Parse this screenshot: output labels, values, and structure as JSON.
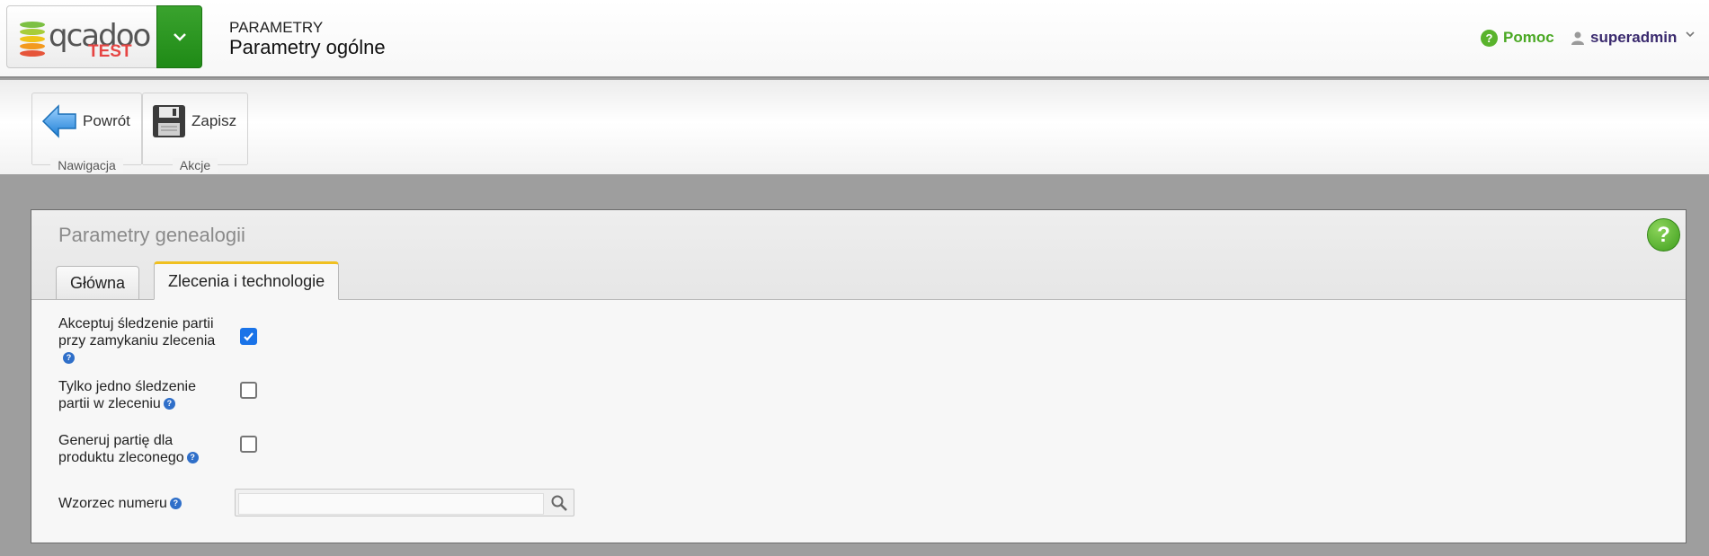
{
  "header": {
    "logo_word": "qcadoo",
    "logo_env": "TEST",
    "section": "PARAMETRY",
    "title": "Parametry ogólne",
    "help_label": "Pomoc",
    "user_label": "superadmin"
  },
  "ribbon": {
    "groups": [
      {
        "caption": "Nawigacja",
        "button": "Powrót",
        "icon": "back-arrow-icon"
      },
      {
        "caption": "Akcje",
        "button": "Zapisz",
        "icon": "floppy-disk-icon"
      }
    ]
  },
  "panel": {
    "title": "Parametry genealogii",
    "tabs": [
      {
        "label": "Główna",
        "active": false
      },
      {
        "label": "Zlecenia i technologie",
        "active": true
      }
    ],
    "fields": [
      {
        "label_line1": "Akceptuj śledzenie partii",
        "label_line2": "przy zamykaniu zlecenia",
        "checked": true
      },
      {
        "label_line1": "Tylko jedno śledzenie",
        "label_line2": "partii w zleceniu",
        "checked": false
      },
      {
        "label_line1": "Generuj partię dla",
        "label_line2": "produktu zleconego",
        "checked": false
      }
    ],
    "lookup": {
      "label": "Wzorzec numeru",
      "value": ""
    }
  },
  "colors": {
    "accent_green": "#1f8a16",
    "tab_active_border": "#f0c020",
    "checkbox_checked": "#1a73e8",
    "help_icon_blue": "#2f6fc9"
  }
}
